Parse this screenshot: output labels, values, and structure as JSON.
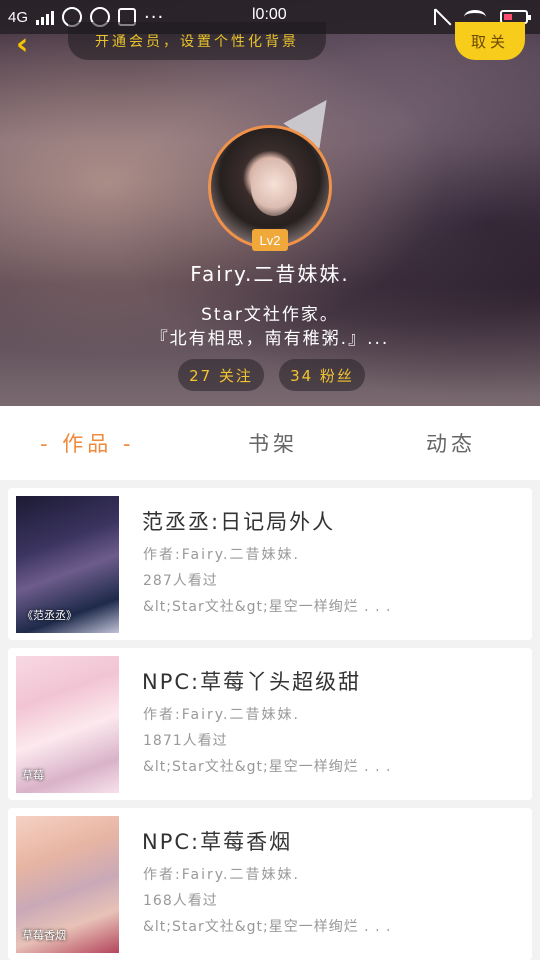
{
  "status_bar": {
    "network": "4G",
    "time": "l0:00",
    "more_dots": "···"
  },
  "header": {
    "back_icon": "chevron-left-icon",
    "vip_banner": "开通会员，设置个性化背景",
    "follow_button": "取关",
    "level": "Lv2",
    "username": "Fairy.二昔妹妹.",
    "bio_line1": "Star文社作家。",
    "bio_line2": "『北有相思，南有稚粥.』...",
    "following": "27 关注",
    "fans": "34 粉丝",
    "accent_color": "#f7cc1b"
  },
  "tabs": [
    {
      "label": "- 作品 -",
      "active": true
    },
    {
      "label": "书架",
      "active": false
    },
    {
      "label": "动态",
      "active": false
    }
  ],
  "books": [
    {
      "title": "范丞丞:日记局外人",
      "author": "作者:Fairy.二昔妹妹.",
      "views": "287人看过",
      "desc": "&lt;Star文社&gt;星空一样绚烂 . . .",
      "cover_tag": "《范丞丞》"
    },
    {
      "title": "NPC:草莓丫头超级甜",
      "author": "作者:Fairy.二昔妹妹.",
      "views": "1871人看过",
      "desc": "&lt;Star文社&gt;星空一样绚烂 . . .",
      "cover_tag": "草莓"
    },
    {
      "title": "NPC:草莓香烟",
      "author": "作者:Fairy.二昔妹妹.",
      "views": "168人看过",
      "desc": "&lt;Star文社&gt;星空一样绚烂 . . .",
      "cover_tag": "草莓香烟"
    }
  ]
}
